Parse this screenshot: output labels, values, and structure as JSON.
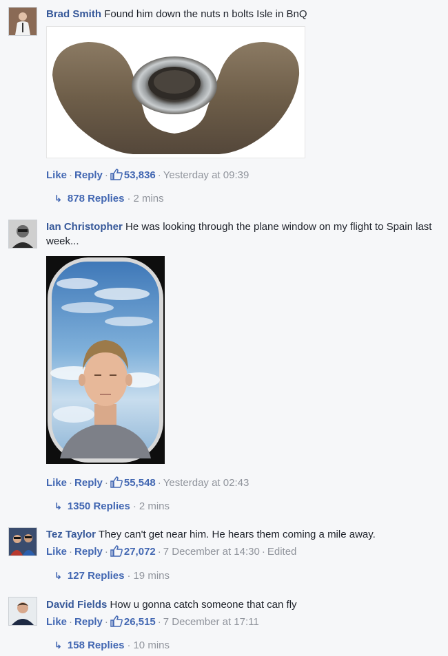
{
  "comments": [
    {
      "author": "Brad Smith",
      "text": "Found him down the nuts n bolts Isle in BnQ",
      "like_label": "Like",
      "reply_label": "Reply",
      "like_count": "53,836",
      "timestamp": "Yesterday at 09:39",
      "edited": "",
      "replies": "878 Replies",
      "replies_time": "2 mins",
      "attachment": "wing-nut-photo"
    },
    {
      "author": "Ian Christopher",
      "text": "He was looking through the plane window on my flight to Spain last week...",
      "like_label": "Like",
      "reply_label": "Reply",
      "like_count": "55,548",
      "timestamp": "Yesterday at 02:43",
      "edited": "",
      "replies": "1350 Replies",
      "replies_time": "2 mins",
      "attachment": "plane-window-photo"
    },
    {
      "author": "Tez Taylor",
      "text": "They can't get near him. He hears them coming a mile away.",
      "like_label": "Like",
      "reply_label": "Reply",
      "like_count": "27,072",
      "timestamp": "7 December at 14:30",
      "edited": "Edited",
      "replies": "127 Replies",
      "replies_time": "19 mins"
    },
    {
      "author": "David Fields",
      "text": "How u gonna catch someone that can fly",
      "like_label": "Like",
      "reply_label": "Reply",
      "like_count": "26,515",
      "timestamp": "7 December at 17:11",
      "edited": "",
      "replies": "158 Replies",
      "replies_time": "10 mins"
    }
  ],
  "colors": {
    "link": "#4267b2",
    "author": "#365899",
    "meta": "#90949c",
    "background": "#f6f7f9"
  },
  "icons": [
    "thumbs-up-icon",
    "reply-arrow-icon"
  ]
}
